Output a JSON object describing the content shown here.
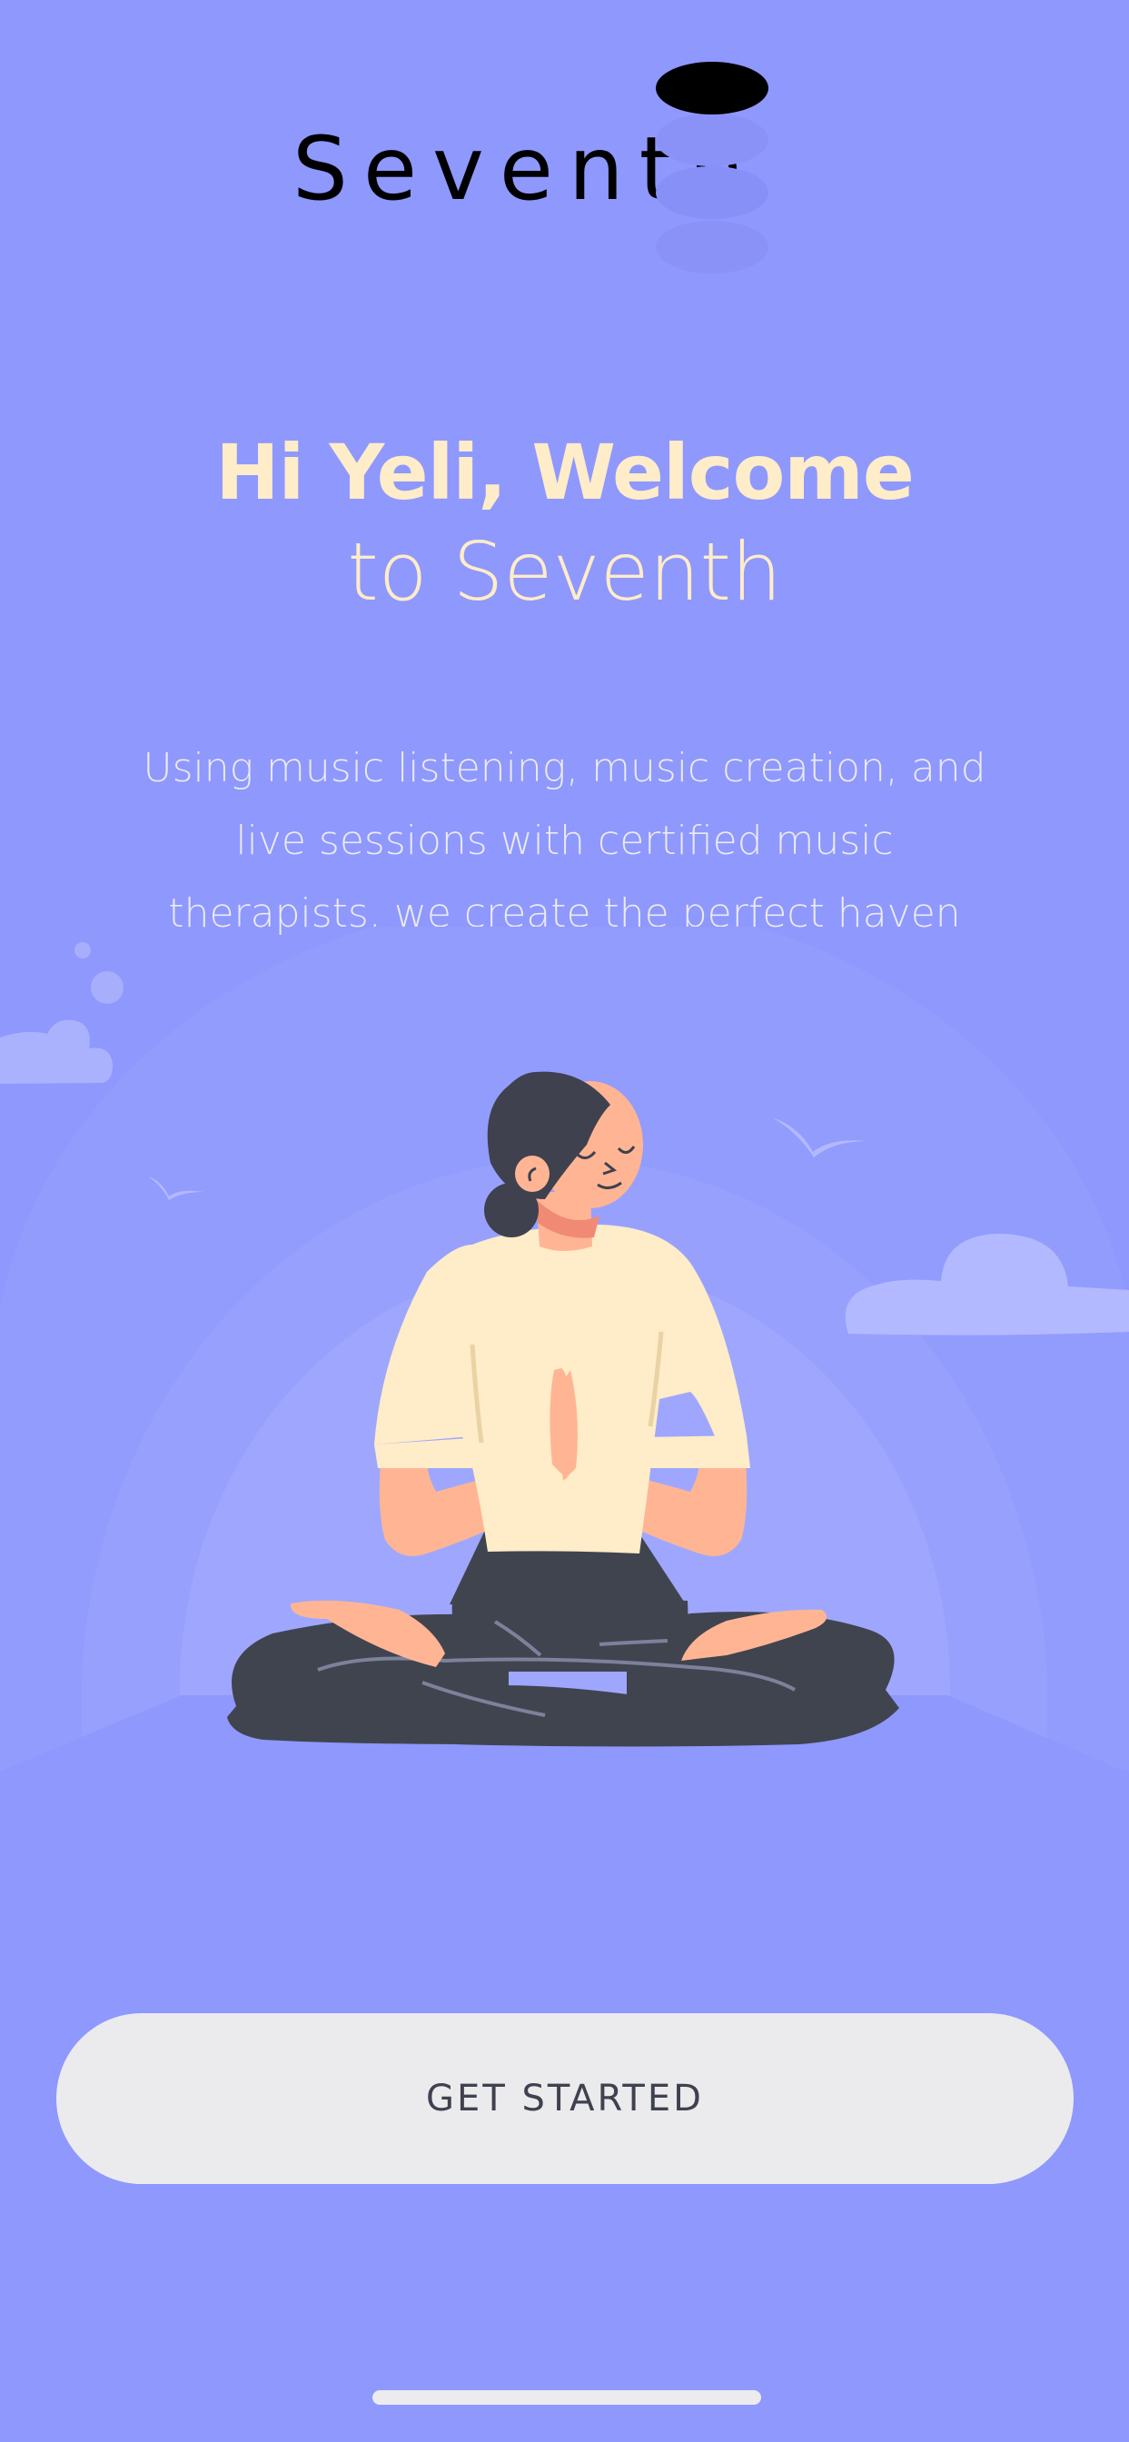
{
  "logo": {
    "wordmark": "Seventh",
    "icon": "stacked-discs-icon"
  },
  "welcome": {
    "line1": "Hi Yeli, Welcome",
    "line2": "to Seventh"
  },
  "description": "Using music listening, music creation, and live sessions with certified music therapists, we create the perfect haven for your mind.",
  "illustration": {
    "icon": "meditating-woman-illustration"
  },
  "cta": {
    "label": "GET STARTED"
  },
  "colors": {
    "background": "#8e98fd",
    "headline": "#ffecc8",
    "button": "#ebebee",
    "button_text": "#3f414e"
  }
}
